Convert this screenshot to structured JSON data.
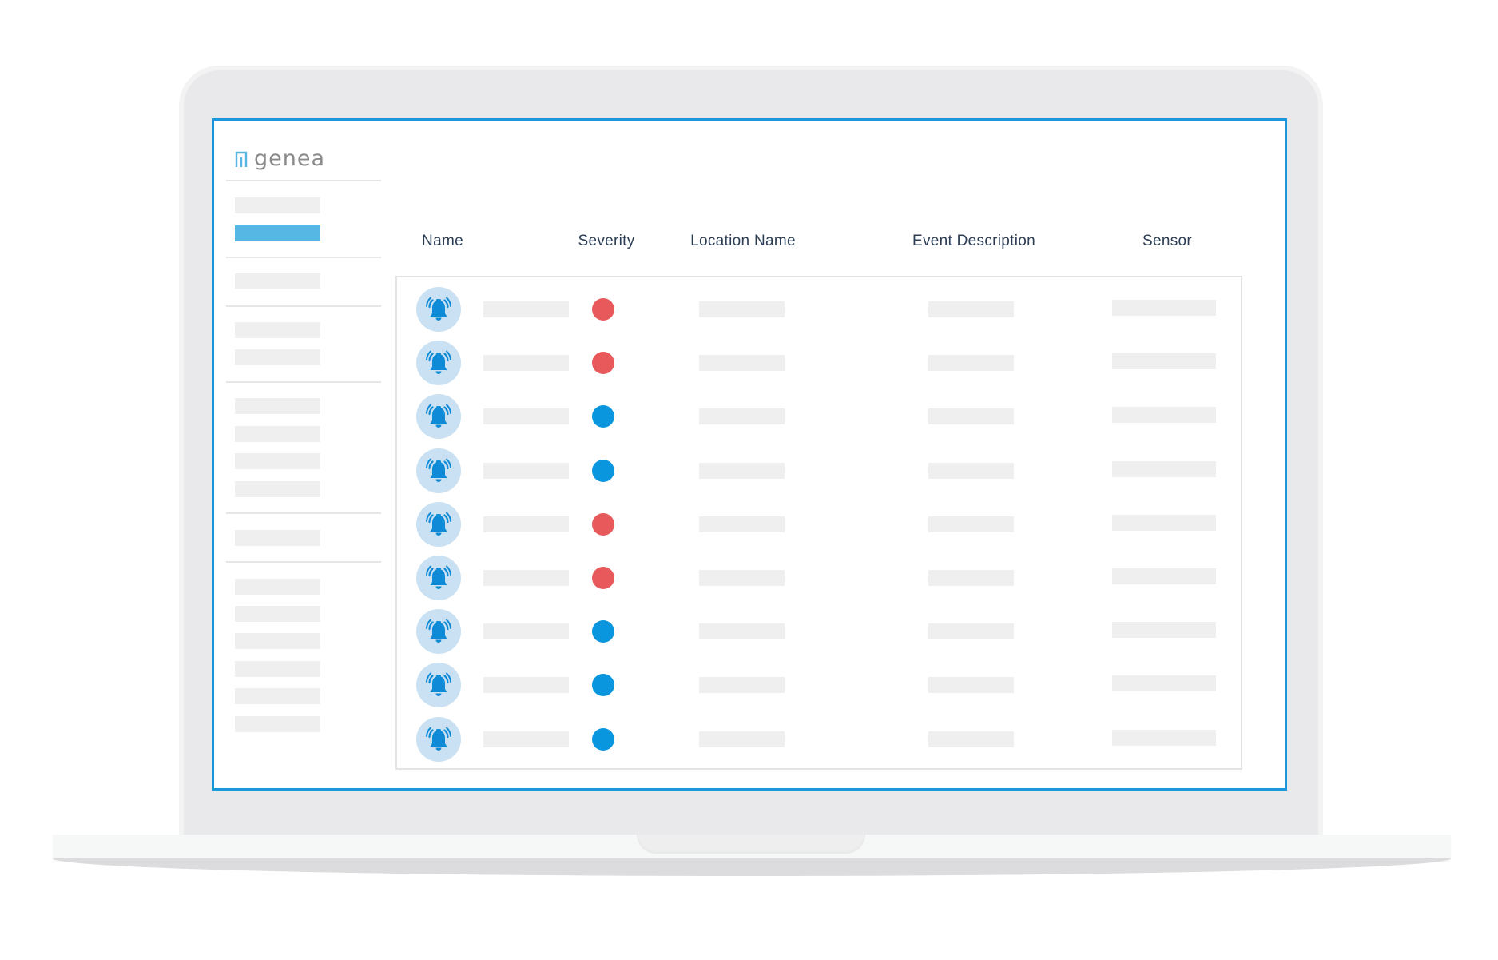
{
  "brand": {
    "name": "genea",
    "icon": "genea-logo-icon",
    "accent_color": "#56b6e4"
  },
  "colors": {
    "screen_border": "#1a97dd",
    "severity_high": "#e8595b",
    "severity_low": "#0a96de",
    "bell": "#0f8ad6",
    "avatar_bg": "#c9e1f2",
    "placeholder": "#efefef"
  },
  "sidebar": {
    "active_index": 1,
    "item_count": 15
  },
  "table": {
    "columns": [
      {
        "key": "name",
        "label": "Name"
      },
      {
        "key": "severity",
        "label": "Severity"
      },
      {
        "key": "location",
        "label": "Location Name"
      },
      {
        "key": "event",
        "label": "Event Description"
      },
      {
        "key": "sensor",
        "label": "Sensor"
      }
    ],
    "rows": [
      {
        "icon": "alarm-bell-icon",
        "severity": "high"
      },
      {
        "icon": "alarm-bell-icon",
        "severity": "high"
      },
      {
        "icon": "alarm-bell-icon",
        "severity": "low"
      },
      {
        "icon": "alarm-bell-icon",
        "severity": "low"
      },
      {
        "icon": "alarm-bell-icon",
        "severity": "high"
      },
      {
        "icon": "alarm-bell-icon",
        "severity": "high"
      },
      {
        "icon": "alarm-bell-icon",
        "severity": "low"
      },
      {
        "icon": "alarm-bell-icon",
        "severity": "low"
      },
      {
        "icon": "alarm-bell-icon",
        "severity": "low"
      }
    ]
  }
}
